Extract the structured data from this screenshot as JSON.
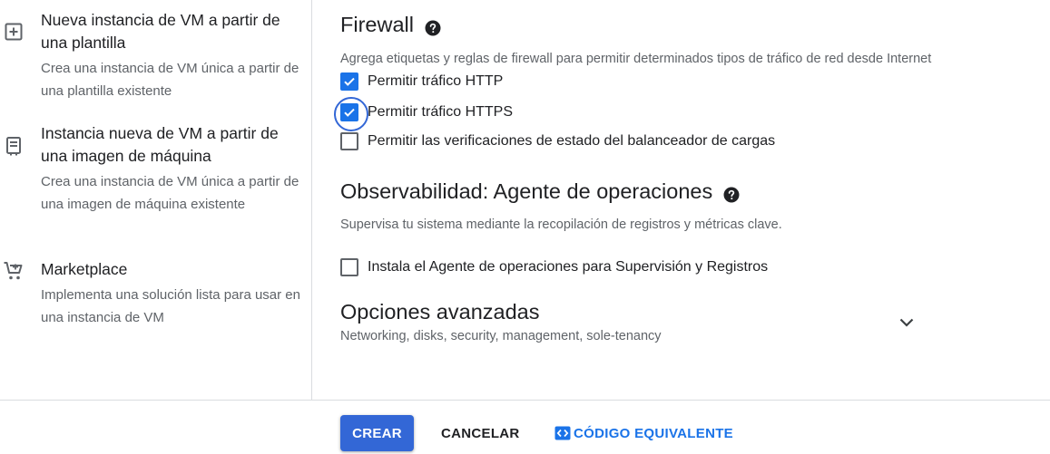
{
  "vm_options": [
    {
      "icon": "add-box-icon",
      "title": "Nueva instancia de VM a partir de una plantilla",
      "description": "Crea una instancia de VM única a partir de una plantilla existente"
    },
    {
      "icon": "machine-image-icon",
      "title": "Instancia nueva de VM a partir de una imagen de máquina",
      "description": "Crea una instancia de VM única a partir de una imagen de máquina existente"
    },
    {
      "icon": "marketplace-cart-icon",
      "title": "Marketplace",
      "description": "Implementa una solución lista para usar en una instancia de VM"
    }
  ],
  "firewall": {
    "title": "Firewall",
    "description": "Agrega etiquetas y reglas de firewall para permitir determinados tipos de tráfico de red desde Internet",
    "checkboxes": [
      {
        "label": "Permitir tráfico HTTP",
        "checked": true
      },
      {
        "label": "Permitir tráfico HTTPS",
        "checked": true,
        "focused": true
      },
      {
        "label": "Permitir las verificaciones de estado del balanceador de cargas",
        "checked": false
      }
    ]
  },
  "observability": {
    "title": "Observabilidad: Agente de operaciones",
    "description": "Supervisa tu sistema mediante la recopilación de registros y métricas clave.",
    "checkbox": {
      "label": "Instala el Agente de operaciones para Supervisión y Registros",
      "checked": false
    }
  },
  "advanced": {
    "title": "Opciones avanzadas",
    "subtitle": "Networking, disks, security, management, sole-tenancy"
  },
  "actions": {
    "create_label": "CREAR",
    "cancel_label": "CANCELAR",
    "code_label": "CÓDIGO EQUIVALENTE"
  },
  "colors": {
    "primary": "#1a73e8",
    "create_button": "#3367d6",
    "text": "#202124",
    "secondary_text": "#5f6368",
    "divider": "#dadce0"
  }
}
